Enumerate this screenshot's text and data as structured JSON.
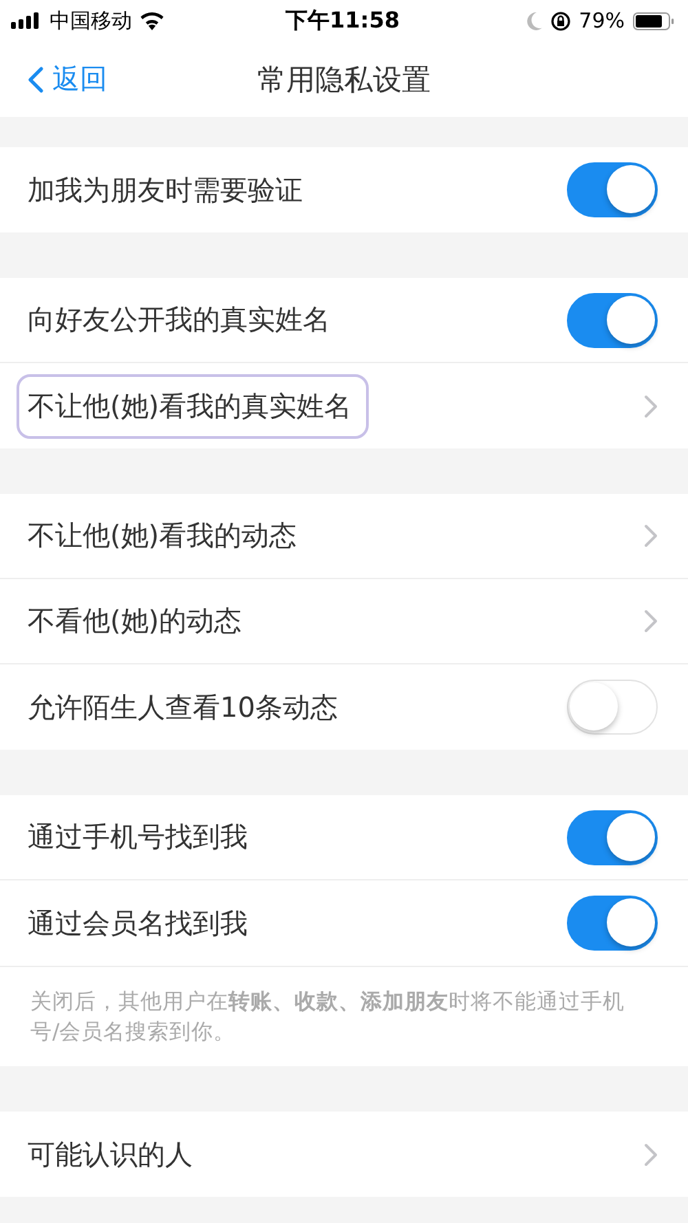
{
  "status_bar": {
    "carrier": "中国移动",
    "time": "下午11:58",
    "battery": "79%"
  },
  "nav": {
    "back": "返回",
    "title": "常用隐私设置"
  },
  "sections": [
    {
      "rows": [
        {
          "kind": "toggle",
          "label": "加我为朋友时需要验证",
          "on": true,
          "highlighted": false
        }
      ]
    },
    {
      "rows": [
        {
          "kind": "toggle",
          "label": "向好友公开我的真实姓名",
          "on": true,
          "highlighted": false
        },
        {
          "kind": "link",
          "label": "不让他(她)看我的真实姓名",
          "highlighted": true
        }
      ]
    },
    {
      "rows": [
        {
          "kind": "link",
          "label": "不让他(她)看我的动态",
          "highlighted": false
        },
        {
          "kind": "link",
          "label": "不看他(她)的动态",
          "highlighted": false
        },
        {
          "kind": "toggle",
          "label": "允许陌生人查看10条动态",
          "on": false,
          "highlighted": false
        }
      ]
    },
    {
      "rows": [
        {
          "kind": "toggle",
          "label": "通过手机号找到我",
          "on": true,
          "highlighted": false
        },
        {
          "kind": "toggle",
          "label": "通过会员名找到我",
          "on": true,
          "highlighted": false
        }
      ],
      "note": "关闭后，其他用户在**转账、收款、添加朋友**时将不能通过手机号/会员名搜索到你。"
    },
    {
      "rows": [
        {
          "kind": "link",
          "label": "可能认识的人",
          "highlighted": false
        }
      ]
    }
  ]
}
